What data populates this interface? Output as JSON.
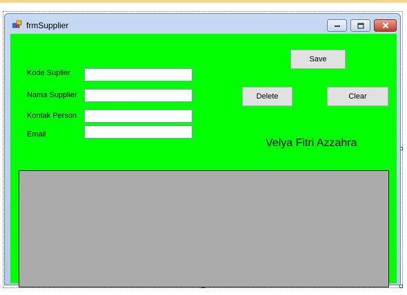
{
  "window": {
    "title": "frmSupplier",
    "icon": "form-icon",
    "background_color": "#00ff00"
  },
  "form": {
    "fields": [
      {
        "label": "Kode Suplier",
        "value": ""
      },
      {
        "label": "Nama Supplier",
        "value": ""
      },
      {
        "label": "Kontak Person",
        "value": ""
      },
      {
        "label": "Email",
        "value": ""
      }
    ]
  },
  "buttons": {
    "save": "Save",
    "delete": "Delete",
    "clear": "Clear"
  },
  "author_label": "Velya Fitri Azzahra",
  "grid": {
    "background_color": "#ababab"
  }
}
